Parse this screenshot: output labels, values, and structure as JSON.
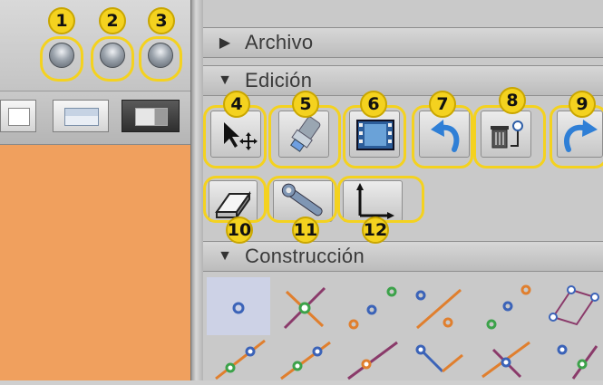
{
  "sections": [
    {
      "label": "Archivo",
      "arrow": "▶",
      "expanded": false
    },
    {
      "label": "Edición",
      "arrow": "▼",
      "expanded": true
    },
    {
      "label": "Construcción",
      "arrow": "▼",
      "expanded": true
    }
  ],
  "badges": [
    "1",
    "2",
    "3",
    "4",
    "5",
    "6",
    "7",
    "8",
    "9",
    "10",
    "11",
    "12"
  ],
  "colors": {
    "accent_yellow": "#f4d21f",
    "left_content": "#f0a05e",
    "undo_blue": "#2f7fd6",
    "point_blue": "#3b63b8",
    "point_green": "#3ca24a",
    "point_orange": "#e07f2e"
  },
  "icons": {
    "btn_4": "select-move-icon",
    "btn_5": "flashlight-icon",
    "btn_6": "film-icon",
    "btn_7": "undo-icon",
    "btn_8": "delete-icon",
    "btn_9": "redo-icon",
    "btn_10": "eraser-icon",
    "btn_11": "wrench-icon",
    "btn_12": "axes-icon"
  }
}
